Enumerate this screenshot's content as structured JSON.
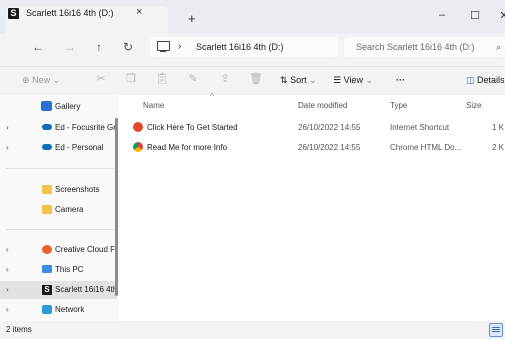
{
  "window": {
    "tab_title": "Scarlett 16i16 4th (D:)",
    "tab_close": "×",
    "new_tab": "+",
    "minimize": "–",
    "maximize": "☐",
    "close": "✕",
    "drive_badge": "S"
  },
  "address": {
    "back": "←",
    "forward": "→",
    "up": "↑",
    "refresh": "↻",
    "chevron": "›",
    "path": "Scarlett 16i16 4th (D:)",
    "search_placeholder": "Search Scarlett 16i16 4th (D:)"
  },
  "toolbar": {
    "new_label": "New",
    "sort_label": "Sort",
    "view_label": "View",
    "more_label": "···",
    "details_label": "Details"
  },
  "sidebar": {
    "items": [
      {
        "label": "Gallery"
      },
      {
        "label": "Ed - Focusrite Gr"
      },
      {
        "label": "Ed - Personal"
      },
      {
        "label": "Screenshots"
      },
      {
        "label": "Camera"
      },
      {
        "label": "Creative Cloud F"
      },
      {
        "label": "This PC"
      },
      {
        "label": "Scarlett 16i16 4th"
      },
      {
        "label": "Network"
      }
    ]
  },
  "columns": {
    "name": "Name",
    "date": "Date modified",
    "type": "Type",
    "size": "Size"
  },
  "files": [
    {
      "name": "Click Here To Get Started",
      "date": "26/10/2022 14:55",
      "type": "Internet Shortcut",
      "size": "1 K"
    },
    {
      "name": "Read Me for more Info",
      "date": "26/10/2022 14:55",
      "type": "Chrome HTML Do...",
      "size": "2 K"
    }
  ],
  "status": {
    "count": "2 items"
  },
  "colors": {
    "accent": "#3b6cc0",
    "folder": "#f2c14e",
    "onedrive": "#0f6cbd"
  }
}
